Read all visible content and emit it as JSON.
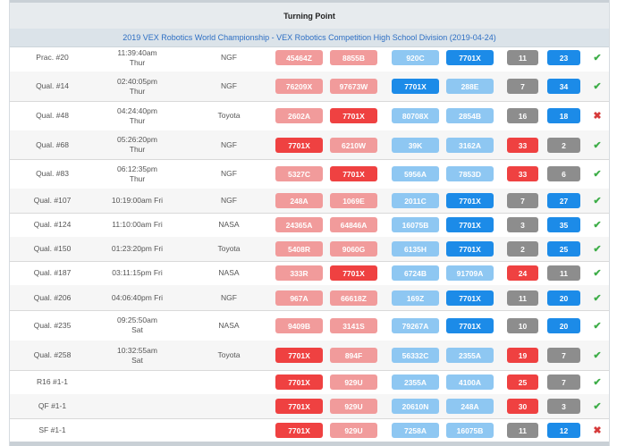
{
  "header": {
    "season": "Turning Point",
    "event": "2019 VEX Robotics World Championship - VEX Robotics Competition High School Division (2019-04-24)"
  },
  "colors": {
    "red_light": "#f19b9b",
    "red_dark": "#ef4141",
    "blue_light": "#8ec7f2",
    "blue_dark": "#1c8be8",
    "score_grey": "#8d8d8d",
    "win": "#3fae49",
    "loss": "#d63a3a"
  },
  "matches": [
    {
      "match": "Prac. #20",
      "time1": "11:39:40am",
      "time2": "Thur",
      "field": "NGF",
      "red1": "45464Z",
      "red2": "8855B",
      "blue1": "920C",
      "blue2": "7701X",
      "hl": "b2",
      "red_score": "11",
      "blue_score": "23",
      "winner": "blue",
      "result": "win"
    },
    {
      "match": "Qual. #14",
      "time1": "02:40:05pm",
      "time2": "Thur",
      "field": "NGF",
      "red1": "76209X",
      "red2": "97673W",
      "blue1": "7701X",
      "blue2": "288E",
      "hl": "b1",
      "red_score": "7",
      "blue_score": "34",
      "winner": "blue",
      "result": "win"
    },
    {
      "match": "Qual. #48",
      "time1": "04:24:40pm",
      "time2": "Thur",
      "field": "Toyota",
      "red1": "2602A",
      "red2": "7701X",
      "blue1": "80708X",
      "blue2": "2854B",
      "hl": "r2",
      "red_score": "16",
      "blue_score": "18",
      "winner": "blue",
      "result": "loss"
    },
    {
      "match": "Qual. #68",
      "time1": "05:26:20pm",
      "time2": "Thur",
      "field": "NGF",
      "red1": "7701X",
      "red2": "6210W",
      "blue1": "39K",
      "blue2": "3162A",
      "hl": "r1",
      "red_score": "33",
      "blue_score": "2",
      "winner": "red",
      "result": "win"
    },
    {
      "match": "Qual. #83",
      "time1": "06:12:35pm",
      "time2": "Thur",
      "field": "NGF",
      "red1": "5327C",
      "red2": "7701X",
      "blue1": "5956A",
      "blue2": "7853D",
      "hl": "r2",
      "red_score": "33",
      "blue_score": "6",
      "winner": "red",
      "result": "win"
    },
    {
      "match": "Qual. #107",
      "time1": "10:19:00am Fri",
      "time2": "",
      "field": "NGF",
      "red1": "248A",
      "red2": "1069E",
      "blue1": "2011C",
      "blue2": "7701X",
      "hl": "b2",
      "red_score": "7",
      "blue_score": "27",
      "winner": "blue",
      "result": "win"
    },
    {
      "match": "Qual. #124",
      "time1": "11:10:00am Fri",
      "time2": "",
      "field": "NASA",
      "red1": "24365A",
      "red2": "64846A",
      "blue1": "16075B",
      "blue2": "7701X",
      "hl": "b2",
      "red_score": "3",
      "blue_score": "35",
      "winner": "blue",
      "result": "win"
    },
    {
      "match": "Qual. #150",
      "time1": "01:23:20pm Fri",
      "time2": "",
      "field": "Toyota",
      "red1": "5408R",
      "red2": "9060G",
      "blue1": "6135H",
      "blue2": "7701X",
      "hl": "b2",
      "red_score": "2",
      "blue_score": "25",
      "winner": "blue",
      "result": "win"
    },
    {
      "match": "Qual. #187",
      "time1": "03:11:15pm Fri",
      "time2": "",
      "field": "NASA",
      "red1": "333R",
      "red2": "7701X",
      "blue1": "6724B",
      "blue2": "91709A",
      "hl": "r2",
      "red_score": "24",
      "blue_score": "11",
      "winner": "red",
      "result": "win"
    },
    {
      "match": "Qual. #206",
      "time1": "04:06:40pm Fri",
      "time2": "",
      "field": "NGF",
      "red1": "967A",
      "red2": "66618Z",
      "blue1": "169Z",
      "blue2": "7701X",
      "hl": "b2",
      "red_score": "11",
      "blue_score": "20",
      "winner": "blue",
      "result": "win"
    },
    {
      "match": "Qual. #235",
      "time1": "09:25:50am",
      "time2": "Sat",
      "field": "NASA",
      "red1": "9409B",
      "red2": "3141S",
      "blue1": "79267A",
      "blue2": "7701X",
      "hl": "b2",
      "red_score": "10",
      "blue_score": "20",
      "winner": "blue",
      "result": "win"
    },
    {
      "match": "Qual. #258",
      "time1": "10:32:55am",
      "time2": "Sat",
      "field": "Toyota",
      "red1": "7701X",
      "red2": "894F",
      "blue1": "56332C",
      "blue2": "2355A",
      "hl": "r1",
      "red_score": "19",
      "blue_score": "7",
      "winner": "red",
      "result": "win"
    },
    {
      "match": "R16 #1-1",
      "time1": "",
      "time2": "",
      "field": "",
      "red1": "7701X",
      "red2": "929U",
      "blue1": "2355A",
      "blue2": "4100A",
      "hl": "r1",
      "red_score": "25",
      "blue_score": "7",
      "winner": "red",
      "result": "win"
    },
    {
      "match": "QF #1-1",
      "time1": "",
      "time2": "",
      "field": "",
      "red1": "7701X",
      "red2": "929U",
      "blue1": "20610N",
      "blue2": "248A",
      "hl": "r1",
      "red_score": "30",
      "blue_score": "3",
      "winner": "red",
      "result": "win"
    },
    {
      "match": "SF #1-1",
      "time1": "",
      "time2": "",
      "field": "",
      "red1": "7701X",
      "red2": "929U",
      "blue1": "7258A",
      "blue2": "16075B",
      "hl": "r1",
      "red_score": "11",
      "blue_score": "12",
      "winner": "blue",
      "result": "loss"
    }
  ]
}
